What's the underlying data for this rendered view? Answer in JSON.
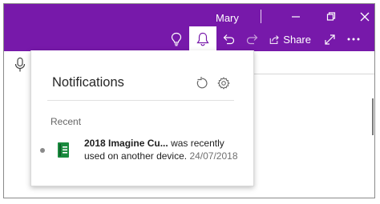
{
  "titlebar": {
    "user_name": "Mary",
    "icons": [
      "minimize-icon",
      "restore-icon",
      "close-icon"
    ]
  },
  "toolbar": {
    "icons": [
      "lightbulb-icon",
      "bell-icon",
      "undo-icon",
      "redo-icon",
      "share-icon",
      "expand-icon",
      "more-icon"
    ],
    "share_label": "Share"
  },
  "notifications": {
    "title": "Notifications",
    "section_label": "Recent",
    "items": [
      {
        "notebook_name": "2018 Imagine Cu...",
        "message_part1": "was recently",
        "message_part2": "used on another device.",
        "date": "24/07/2018",
        "icon": "onenote-notebook-icon"
      }
    ]
  },
  "colors": {
    "brand": "#7719aa",
    "notebook_green": "#1a8a3e"
  }
}
